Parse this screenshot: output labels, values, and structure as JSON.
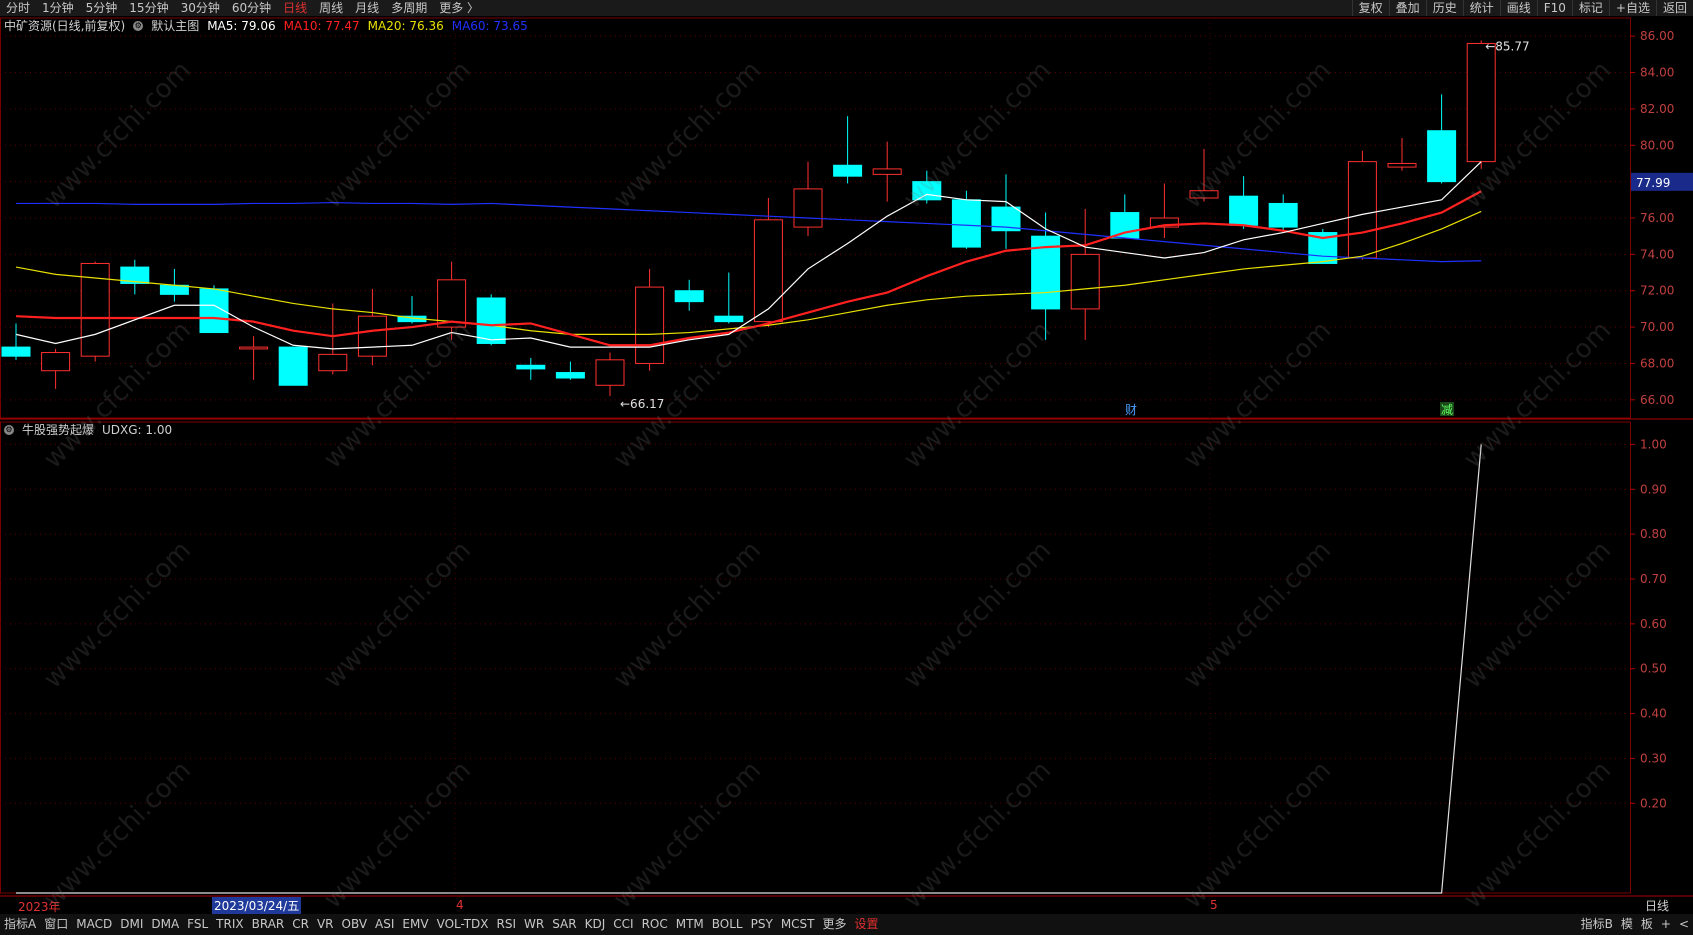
{
  "topbar": {
    "periods": [
      "分时",
      "1分钟",
      "5分钟",
      "15分钟",
      "30分钟",
      "60分钟",
      "日线",
      "周线",
      "月线",
      "多周期",
      "更多 〉"
    ],
    "active": "日线",
    "tools": [
      "复权",
      "叠加",
      "历史",
      "统计",
      "画线",
      "F10",
      "标记",
      "+自选",
      "返回"
    ]
  },
  "main_legend": {
    "title": "中矿资源(日线,前复权)",
    "template": "默认主图",
    "ma5": "MA5: 79.06",
    "ma10": "MA10: 77.47",
    "ma20": "MA20: 76.36",
    "ma60": "MA60: 73.65",
    "colors": {
      "ma5": "#ffffff",
      "ma10": "#ff2020",
      "ma20": "#e8e000",
      "ma60": "#2030ff",
      "up": "#ff3030",
      "down": "#00ffff"
    }
  },
  "indicator_legend": {
    "name": "牛股强势起爆",
    "value": "UDXG: 1.00"
  },
  "price_axis": [
    "86.00",
    "84.00",
    "82.00",
    "80.00",
    "78.00",
    "76.00",
    "74.00",
    "72.00",
    "70.00",
    "68.00",
    "66.00"
  ],
  "price_tag": "77.99",
  "indicator_axis": [
    "1.00",
    "0.90",
    "0.80",
    "0.70",
    "0.60",
    "0.50",
    "0.40",
    "0.30",
    "0.20"
  ],
  "annotations": {
    "high": "85.77",
    "low": "66.17",
    "marker_cai": "财",
    "marker_jian": "减"
  },
  "date_strip": {
    "year": "2023年",
    "cursor_date": "2023/03/24/五",
    "month4": "4",
    "month5": "5",
    "period": "日线"
  },
  "bottom_tabs": [
    "指标A",
    "窗口",
    "MACD",
    "DMI",
    "DMA",
    "FSL",
    "TRIX",
    "BRAR",
    "CR",
    "VR",
    "OBV",
    "ASI",
    "EMV",
    "VOL-TDX",
    "RSI",
    "WR",
    "SAR",
    "KDJ",
    "CCI",
    "ROC",
    "MTM",
    "BOLL",
    "PSY",
    "MCST",
    "更多",
    "设置"
  ],
  "bottom_right": [
    "指标B",
    "模",
    "板",
    "+",
    "<"
  ],
  "watermark": "www.cfchi.com",
  "chart_data": {
    "type": "candlestick",
    "ylim": [
      65,
      87
    ],
    "candles": [
      {
        "o": 68.9,
        "h": 70.2,
        "l": 68.2,
        "c": 68.4
      },
      {
        "o": 67.6,
        "h": 68.8,
        "l": 66.6,
        "c": 68.6
      },
      {
        "o": 68.4,
        "h": 73.6,
        "l": 68.1,
        "c": 73.5
      },
      {
        "o": 73.3,
        "h": 73.7,
        "l": 71.8,
        "c": 72.4
      },
      {
        "o": 72.3,
        "h": 73.2,
        "l": 71.4,
        "c": 71.8
      },
      {
        "o": 72.1,
        "h": 72.3,
        "l": 69.7,
        "c": 69.7
      },
      {
        "o": 68.8,
        "h": 69.5,
        "l": 67.1,
        "c": 68.9
      },
      {
        "o": 68.9,
        "h": 68.9,
        "l": 66.8,
        "c": 66.8
      },
      {
        "o": 67.6,
        "h": 71.3,
        "l": 67.4,
        "c": 68.5
      },
      {
        "o": 68.4,
        "h": 72.1,
        "l": 67.9,
        "c": 70.6
      },
      {
        "o": 70.6,
        "h": 71.7,
        "l": 70.2,
        "c": 70.3
      },
      {
        "o": 70.0,
        "h": 73.6,
        "l": 69.3,
        "c": 72.6
      },
      {
        "o": 71.6,
        "h": 71.8,
        "l": 69.0,
        "c": 69.1
      },
      {
        "o": 67.9,
        "h": 68.3,
        "l": 67.1,
        "c": 67.7
      },
      {
        "o": 67.5,
        "h": 68.1,
        "l": 67.1,
        "c": 67.2
      },
      {
        "o": 66.8,
        "h": 68.6,
        "l": 66.2,
        "c": 68.2
      },
      {
        "o": 68.0,
        "h": 73.2,
        "l": 67.6,
        "c": 72.2
      },
      {
        "o": 72.0,
        "h": 72.6,
        "l": 70.9,
        "c": 71.4
      },
      {
        "o": 70.6,
        "h": 73.0,
        "l": 70.2,
        "c": 70.3
      },
      {
        "o": 70.3,
        "h": 77.1,
        "l": 70.0,
        "c": 75.9
      },
      {
        "o": 75.5,
        "h": 79.1,
        "l": 75.0,
        "c": 77.6
      },
      {
        "o": 78.9,
        "h": 81.6,
        "l": 77.9,
        "c": 78.3
      },
      {
        "o": 78.4,
        "h": 80.2,
        "l": 76.9,
        "c": 78.7
      },
      {
        "o": 78.0,
        "h": 78.6,
        "l": 76.8,
        "c": 77.0
      },
      {
        "o": 77.0,
        "h": 77.5,
        "l": 74.3,
        "c": 74.4
      },
      {
        "o": 76.6,
        "h": 78.4,
        "l": 74.3,
        "c": 75.3
      },
      {
        "o": 75.0,
        "h": 76.3,
        "l": 69.3,
        "c": 71.0
      },
      {
        "o": 71.0,
        "h": 76.5,
        "l": 69.3,
        "c": 74.0
      },
      {
        "o": 76.3,
        "h": 77.3,
        "l": 74.9,
        "c": 74.9
      },
      {
        "o": 75.5,
        "h": 77.9,
        "l": 74.9,
        "c": 76.0
      },
      {
        "o": 77.1,
        "h": 79.8,
        "l": 76.9,
        "c": 77.5
      },
      {
        "o": 77.2,
        "h": 78.3,
        "l": 75.4,
        "c": 75.6
      },
      {
        "o": 76.8,
        "h": 77.3,
        "l": 75.3,
        "c": 75.5
      },
      {
        "o": 75.2,
        "h": 75.4,
        "l": 73.5,
        "c": 73.5
      },
      {
        "o": 73.8,
        "h": 79.7,
        "l": 73.7,
        "c": 79.1
      },
      {
        "o": 78.8,
        "h": 80.4,
        "l": 78.6,
        "c": 79.0
      },
      {
        "o": 80.8,
        "h": 82.8,
        "l": 77.9,
        "c": 78.0
      },
      {
        "o": 79.1,
        "h": 85.77,
        "l": 78.7,
        "c": 85.6
      }
    ],
    "ma5": [
      69.6,
      69.1,
      69.6,
      70.4,
      71.2,
      71.2,
      70.0,
      69.0,
      68.8,
      68.9,
      69.0,
      69.7,
      69.3,
      69.4,
      68.9,
      68.9,
      68.9,
      69.3,
      69.6,
      71.0,
      73.2,
      74.6,
      76.1,
      77.3,
      77.0,
      76.9,
      75.4,
      74.4,
      74.1,
      73.8,
      74.1,
      74.8,
      75.2,
      75.7,
      76.2,
      76.6,
      77.0,
      79.1
    ],
    "ma10": [
      70.6,
      70.5,
      70.5,
      70.5,
      70.5,
      70.5,
      70.3,
      69.8,
      69.5,
      69.8,
      70.0,
      70.3,
      70.1,
      70.2,
      69.6,
      69.0,
      69.0,
      69.4,
      69.7,
      70.2,
      70.8,
      71.4,
      71.9,
      72.8,
      73.6,
      74.2,
      74.4,
      74.5,
      75.2,
      75.6,
      75.7,
      75.6,
      75.3,
      74.9,
      75.2,
      75.7,
      76.3,
      77.47
    ],
    "ma20": [
      73.3,
      72.9,
      72.7,
      72.5,
      72.3,
      72.1,
      71.7,
      71.3,
      71.0,
      70.8,
      70.5,
      70.3,
      70.1,
      69.8,
      69.6,
      69.6,
      69.6,
      69.7,
      69.9,
      70.1,
      70.4,
      70.8,
      71.2,
      71.5,
      71.7,
      71.8,
      71.9,
      72.1,
      72.3,
      72.6,
      72.9,
      73.2,
      73.4,
      73.6,
      73.9,
      74.6,
      75.4,
      76.36
    ],
    "ma60": [
      76.8,
      76.8,
      76.8,
      76.75,
      76.75,
      76.75,
      76.8,
      76.8,
      76.85,
      76.8,
      76.8,
      76.75,
      76.8,
      76.7,
      76.6,
      76.5,
      76.4,
      76.3,
      76.2,
      76.1,
      76.0,
      75.9,
      75.8,
      75.7,
      75.6,
      75.5,
      75.3,
      75.1,
      74.9,
      74.7,
      74.5,
      74.3,
      74.1,
      73.9,
      73.8,
      73.7,
      73.6,
      73.65
    ],
    "udxg": [
      0,
      0,
      0,
      0,
      0,
      0,
      0,
      0,
      0,
      0,
      0,
      0,
      0,
      0,
      0,
      0,
      0,
      0,
      0,
      0,
      0,
      0,
      0,
      0,
      0,
      0,
      0,
      0,
      0,
      0,
      0,
      0,
      0,
      0,
      0,
      0,
      0,
      1
    ],
    "udxg_ylim": [
      0,
      1.05
    ]
  }
}
